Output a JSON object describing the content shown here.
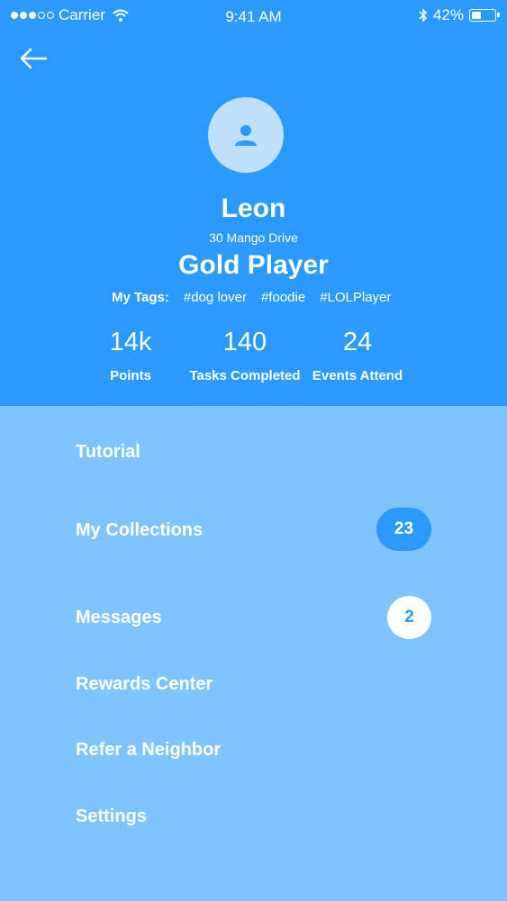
{
  "status_bar": {
    "carrier": "Carrier",
    "time": "9:41 AM",
    "battery": "42%"
  },
  "profile": {
    "name": "Leon",
    "address": "30 Mango Drive",
    "level": "Gold Player",
    "tags_label": "My Tags:",
    "tags": [
      "#dog lover",
      "#foodie",
      "#LOLPlayer"
    ]
  },
  "stats": [
    {
      "value": "14k",
      "label": "Points"
    },
    {
      "value": "140",
      "label": "Tasks Completed"
    },
    {
      "value": "24",
      "label": "Events Attend"
    }
  ],
  "menu": [
    {
      "label": "Tutorial"
    },
    {
      "label": "My Collections",
      "badge": "23"
    },
    {
      "label": "Messages",
      "badge": "2"
    },
    {
      "label": "Rewards Center"
    },
    {
      "label": "Refer a Neighbor"
    },
    {
      "label": "Settings"
    }
  ],
  "colors": {
    "header": "#2a9aff",
    "body": "#80c4ff",
    "avatar": "#bfe0ff"
  },
  "icons": {
    "back": "arrow-left-icon",
    "avatar": "person-icon",
    "wifi": "wifi-icon",
    "bluetooth": "bluetooth-icon",
    "battery": "battery-icon"
  }
}
